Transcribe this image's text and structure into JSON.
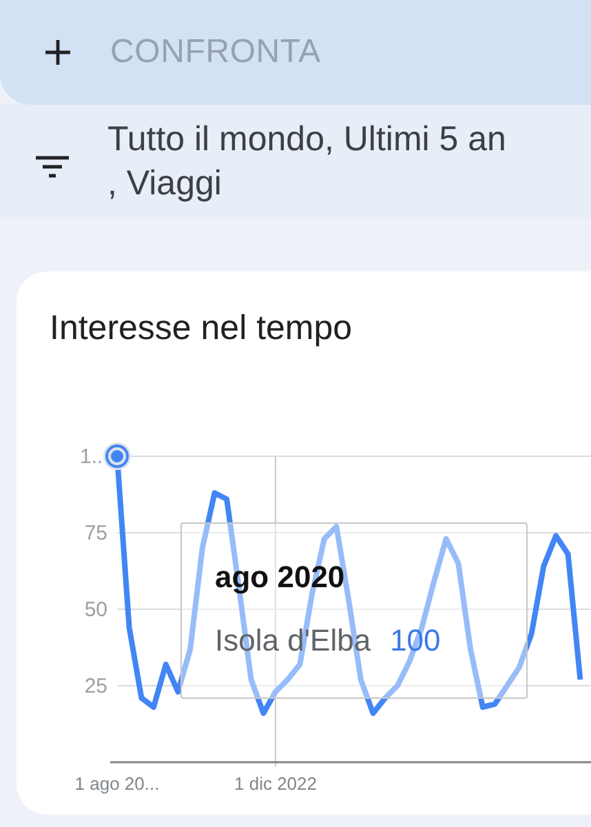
{
  "compare_bar": {
    "label": "CONFRONTA"
  },
  "filters": {
    "lines": [
      "Tutto il mondo, Ultimi 5 an",
      ", Viaggi"
    ]
  },
  "interest_card": {
    "title": "Interesse nel tempo",
    "y_top_label": "1..",
    "chart_data": {
      "type": "line",
      "categories": [
        "1 ago 20...",
        null,
        null,
        null,
        null,
        null,
        null,
        null,
        null,
        null,
        null,
        null,
        null,
        "1 dic 2022",
        null,
        null,
        null,
        null,
        null,
        null,
        null,
        null,
        null,
        null,
        null,
        null,
        null,
        null,
        null,
        null,
        null,
        null,
        null,
        null,
        null,
        null,
        null,
        null,
        null
      ],
      "series": [
        {
          "name": "Isola d'Elba",
          "color": "#4285f4",
          "values": [
            100,
            44,
            21,
            18,
            32,
            23,
            37,
            70,
            88,
            86,
            57,
            27,
            16,
            23,
            27,
            32,
            55,
            73,
            77,
            53,
            27,
            16,
            21,
            25,
            33,
            44,
            59,
            73,
            65,
            37,
            18,
            19,
            25,
            31,
            42,
            64,
            74,
            68,
            27
          ]
        }
      ],
      "ylim": [
        0,
        100
      ],
      "yticks": [
        25,
        50,
        75
      ],
      "grid": true
    },
    "tooltip": {
      "shown": true,
      "title": "ago 2020",
      "value": "100"
    }
  }
}
